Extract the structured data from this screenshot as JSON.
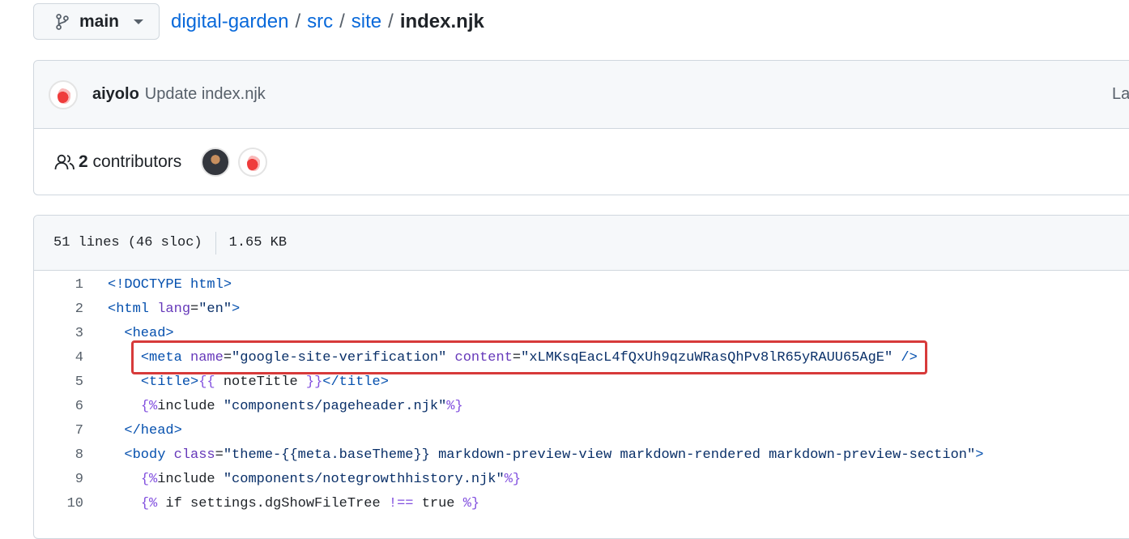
{
  "breadcrumb": {
    "branch": "main",
    "repo": "digital-garden",
    "sep1": "/",
    "dir1": "src",
    "sep2": "/",
    "dir2": "site",
    "sep3": "/",
    "file": "index.njk"
  },
  "commit": {
    "author": "aiyolo",
    "message": "Update index.njk",
    "right_text": "La"
  },
  "contributors": {
    "count": "2",
    "label": "contributors"
  },
  "file": {
    "lines_info": "51 lines (46 sloc)",
    "size": "1.65 KB"
  },
  "code_lines": [
    {
      "num": "1",
      "indent": "",
      "parts": [
        [
          "tag",
          "<!DOCTYPE html>"
        ]
      ]
    },
    {
      "num": "2",
      "indent": "",
      "parts": [
        [
          "tag",
          "<html "
        ],
        [
          "attr",
          "lang"
        ],
        [
          "plain",
          "="
        ],
        [
          "str",
          "\"en\""
        ],
        [
          "tag",
          ">"
        ]
      ]
    },
    {
      "num": "3",
      "indent": "  ",
      "parts": [
        [
          "tag",
          "<head>"
        ]
      ]
    },
    {
      "num": "4",
      "indent": "    ",
      "parts": [
        [
          "tag",
          "<meta "
        ],
        [
          "attr",
          "name"
        ],
        [
          "plain",
          "="
        ],
        [
          "str",
          "\"google-site-verification\" "
        ],
        [
          "attr",
          "content"
        ],
        [
          "plain",
          "="
        ],
        [
          "str",
          "\"xLMKsqEacL4fQxUh9qzuWRasQhPv8lR65yRAUU65AgE\""
        ],
        [
          "tag",
          " />"
        ]
      ]
    },
    {
      "num": "5",
      "indent": "    ",
      "parts": [
        [
          "tag",
          "<title>"
        ],
        [
          "tpl",
          "{{ "
        ],
        [
          "plain",
          "noteTitle "
        ],
        [
          "tpl",
          "}}"
        ],
        [
          "tag",
          "</title>"
        ]
      ]
    },
    {
      "num": "6",
      "indent": "    ",
      "parts": [
        [
          "tpl",
          "{%"
        ],
        [
          "plain",
          "include "
        ],
        [
          "str",
          "\"components/pageheader.njk\""
        ],
        [
          "tpl",
          "%}"
        ]
      ]
    },
    {
      "num": "7",
      "indent": "  ",
      "parts": [
        [
          "tag",
          "</head>"
        ]
      ]
    },
    {
      "num": "8",
      "indent": "  ",
      "parts": [
        [
          "tag",
          "<body "
        ],
        [
          "attr",
          "class"
        ],
        [
          "plain",
          "="
        ],
        [
          "str",
          "\"theme-{{meta.baseTheme}} markdown-preview-view markdown-rendered markdown-preview-section\""
        ],
        [
          "tag",
          ">"
        ]
      ]
    },
    {
      "num": "9",
      "indent": "    ",
      "parts": [
        [
          "tpl",
          "{%"
        ],
        [
          "plain",
          "include "
        ],
        [
          "str",
          "\"components/notegrowthhistory.njk\""
        ],
        [
          "tpl",
          "%}"
        ]
      ]
    },
    {
      "num": "10",
      "indent": "    ",
      "parts": [
        [
          "tpl",
          "{% "
        ],
        [
          "plain",
          "if settings.dgShowFileTree "
        ],
        [
          "tpl",
          "!== "
        ],
        [
          "plain",
          "true "
        ],
        [
          "tpl",
          "%}"
        ]
      ]
    }
  ]
}
